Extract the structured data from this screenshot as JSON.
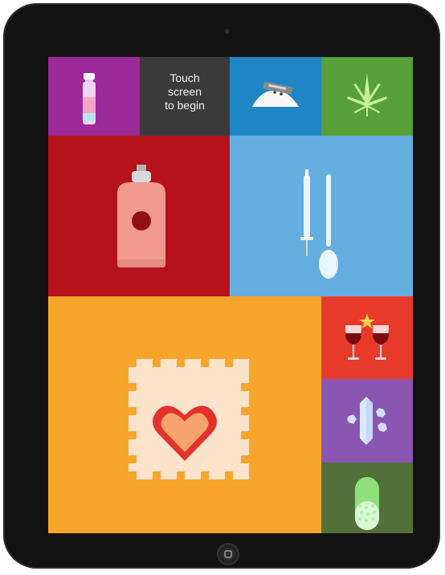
{
  "start_prompt": {
    "line1": "Touch",
    "line2": "screen",
    "line3": "to begin"
  },
  "tiles": [
    {
      "id": "bottle",
      "color": "#9b2a98",
      "icon": "bottle-icon"
    },
    {
      "id": "start",
      "color": "#3a3a3a",
      "icon": "none"
    },
    {
      "id": "powder",
      "color": "#1f86c6",
      "icon": "powder-razor-icon"
    },
    {
      "id": "leaf",
      "color": "#57a03a",
      "icon": "cannabis-leaf-icon"
    },
    {
      "id": "spray",
      "color": "#b5121b",
      "icon": "spray-can-icon"
    },
    {
      "id": "needle",
      "color": "#64aee0",
      "icon": "syringe-spoon-icon"
    },
    {
      "id": "tab",
      "color": "#f7a52b",
      "icon": "blotter-heart-icon"
    },
    {
      "id": "wine",
      "color": "#e73a2a",
      "icon": "wine-glasses-icon"
    },
    {
      "id": "crystal",
      "color": "#8a55b1",
      "icon": "crystals-icon"
    },
    {
      "id": "pill",
      "color": "#52703a",
      "icon": "capsule-icon"
    }
  ]
}
